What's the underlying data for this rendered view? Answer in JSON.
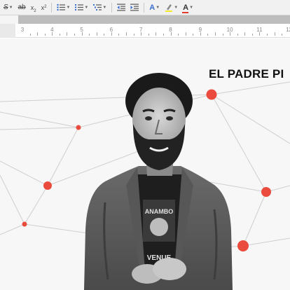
{
  "toolbar": {
    "strikethrough_label": "S",
    "abc_label": "ab",
    "subscript_label": "x",
    "superscript_label": "x",
    "icons": [
      "strikethrough-icon",
      "text-style-icon",
      "subscript-icon",
      "superscript-icon",
      "bullet-list-icon",
      "numbered-list-icon",
      "multilevel-list-icon",
      "decrease-indent-icon",
      "increase-indent-icon",
      "text-effects-icon",
      "highlight-icon",
      "font-color-icon"
    ],
    "colors": {
      "highlight": "#f7e82e",
      "font_color": "#e23b2e"
    }
  },
  "ruler": {
    "numbers": [
      "3",
      "4",
      "5",
      "6",
      "7",
      "8",
      "9",
      "10",
      "11",
      "12"
    ]
  },
  "document": {
    "headline": "EL PADRE PI",
    "accent_color": "#ea4b3c",
    "photo_shirt_text_1": "ANAMBO",
    "photo_shirt_text_2": "VENUE"
  }
}
